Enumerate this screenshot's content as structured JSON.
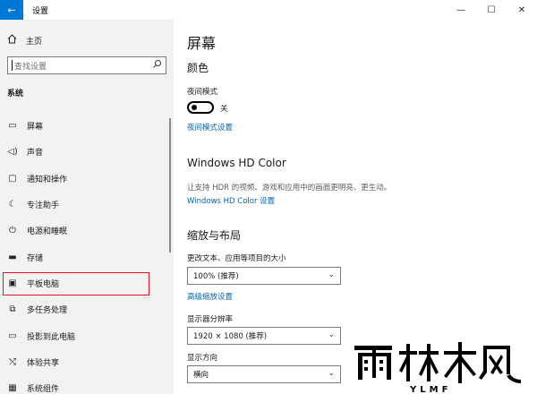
{
  "window": {
    "back_icon": "arrow-left-icon",
    "title": "设置"
  },
  "sidebar": {
    "home_label": "主页",
    "search_placeholder": "查找设置",
    "section": "系统",
    "items": [
      {
        "label": "屏幕",
        "icon": "monitor-icon"
      },
      {
        "label": "声音",
        "icon": "speaker-icon"
      },
      {
        "label": "通知和操作",
        "icon": "notification-icon"
      },
      {
        "label": "专注助手",
        "icon": "moon-icon"
      },
      {
        "label": "电源和睡眠",
        "icon": "power-icon"
      },
      {
        "label": "存储",
        "icon": "storage-icon"
      },
      {
        "label": "平板电脑",
        "icon": "tablet-icon",
        "selected": true
      },
      {
        "label": "多任务处理",
        "icon": "multitask-icon"
      },
      {
        "label": "投影到此电脑",
        "icon": "project-icon"
      },
      {
        "label": "体验共享",
        "icon": "share-icon"
      },
      {
        "label": "系统组件",
        "icon": "components-icon"
      }
    ]
  },
  "main": {
    "title": "屏幕",
    "color_heading": "颜色",
    "night_mode_label": "夜间模式",
    "night_mode_state": "关",
    "night_mode_link": "夜间模式设置",
    "hdr_heading": "Windows HD Color",
    "hdr_desc": "让支持 HDR 的视频、游戏和应用中的画面更明亮、更生动。",
    "hdr_link": "Windows HD Color 设置",
    "scale_heading": "缩放与布局",
    "scale_label": "更改文本、应用等项目的大小",
    "scale_value": "100% (推荐)",
    "scale_link": "高级缩放设置",
    "resolution_label": "显示器分辨率",
    "resolution_value": "1920 × 1080 (推荐)",
    "orientation_label": "显示方向",
    "orientation_value": "横向"
  },
  "watermark": {
    "brand": "雨林木风",
    "sub": "YLMF"
  },
  "colors": {
    "accent": "#0078d7",
    "link": "#0063b1",
    "highlight_border": "#e81123",
    "sidebar_bg": "#f2f2f2"
  }
}
